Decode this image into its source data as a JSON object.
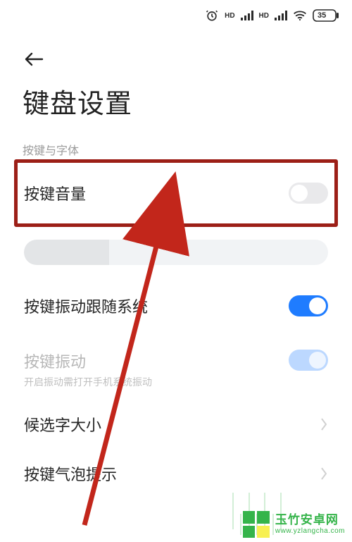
{
  "status": {
    "battery_percent": "35",
    "icons": [
      "alarm",
      "hd1",
      "signal1",
      "hd2",
      "signal2",
      "wifi",
      "battery"
    ]
  },
  "page": {
    "title": "键盘设置"
  },
  "section": {
    "label": "按键与字体"
  },
  "rows": {
    "volume": {
      "label": "按键音量",
      "toggle": "off"
    },
    "slider": {
      "value_pct": 28
    },
    "vibfollow": {
      "label": "按键振动跟随系统",
      "toggle": "on"
    },
    "vib": {
      "label": "按键振动",
      "sub": "开启振动需打开手机系统振动",
      "toggle": "disabled_on"
    },
    "fontsize": {
      "label": "候选字大小"
    },
    "bubble": {
      "label": "按键气泡提示"
    }
  },
  "watermark": {
    "name": "玉竹安卓网",
    "url": "www.yzlangcha.com"
  }
}
